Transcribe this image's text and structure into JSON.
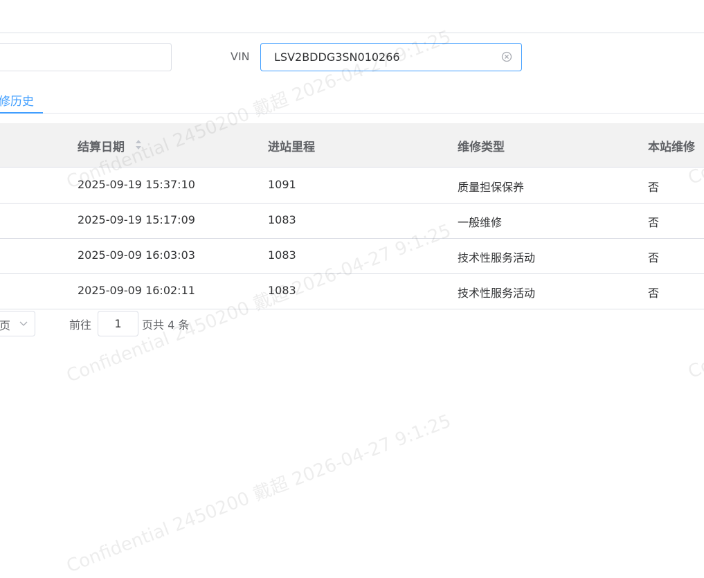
{
  "search": {
    "vin_label": "VIN",
    "vin_value": "LSV2BDDG3SN010266",
    "left_value": ""
  },
  "tabs": [
    {
      "label": "修历史"
    }
  ],
  "table": {
    "columns": [
      "结算日期",
      "进站里程",
      "维修类型",
      "本站维修"
    ],
    "rows": [
      {
        "date": "2025-09-19 15:37:10",
        "mileage": "1091",
        "type": "质量担保保养",
        "local": "否"
      },
      {
        "date": "2025-09-19 15:17:09",
        "mileage": "1083",
        "type": "一般维修",
        "local": "否"
      },
      {
        "date": "2025-09-09 16:03:03",
        "mileage": "1083",
        "type": "技术性服务活动",
        "local": "否"
      },
      {
        "date": "2025-09-09 16:02:11",
        "mileage": "1083",
        "type": "技术性服务活动",
        "local": "否"
      }
    ]
  },
  "pagination": {
    "size_label": "页",
    "goto_label": "前往",
    "page_value": "1",
    "total_label": "页共 4 条"
  },
  "watermark": {
    "line1": "Confidential 2450200 戴超 2026-04-27 9:1:25",
    "fragment": "Co"
  },
  "colors": {
    "accent": "#409eff",
    "header_bg": "#f2f2f2",
    "border": "#dcdfe6"
  },
  "icons": {
    "clear": "circle-x-icon",
    "sort": "sort-caret-icon",
    "select": "chevron-down-icon"
  }
}
